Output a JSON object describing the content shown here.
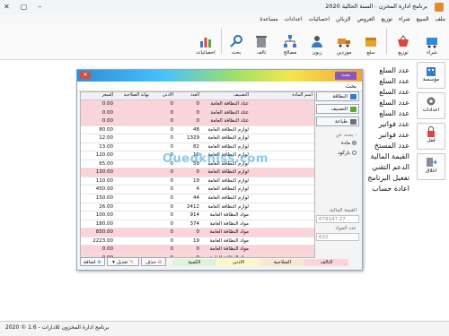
{
  "window": {
    "title": "برنامج ادارة المخزن - السنة الحالية 2020"
  },
  "menu": [
    "ملف",
    "المبيع",
    "شراء",
    "توزيع",
    "العروض",
    "الزبائن",
    "احصائيات",
    "اعدادات",
    "مساعدة"
  ],
  "toolbar": [
    {
      "label": "شراء",
      "icon": "cart-icon"
    },
    {
      "label": "توزيع",
      "icon": "basket-icon"
    },
    {
      "label": "سلع",
      "icon": "box-icon"
    },
    {
      "label": "موردين",
      "icon": "truck-icon"
    },
    {
      "label": "زبون",
      "icon": "person-icon"
    },
    {
      "label": "مصالح",
      "icon": "network-icon"
    },
    {
      "label": "تالف",
      "icon": "trash-icon"
    },
    {
      "label": "بحث",
      "icon": "search-icon"
    },
    {
      "label": "احصائيات",
      "icon": "chart-icon"
    }
  ],
  "sidebar": [
    {
      "label": "مؤسسة",
      "icon": "building-icon"
    },
    {
      "label": "اعدادات",
      "icon": "gear-icon"
    },
    {
      "label": "قفل",
      "icon": "lock-icon"
    },
    {
      "label": "اغلاق",
      "icon": "exit-icon"
    }
  ],
  "background_labels": [
    "عدد السلع",
    "عدد السلع",
    "عدد السلع",
    "عدد السلع",
    "عدد السلع",
    "عدد فواتير",
    "عدد فواتير",
    "عدد المستخ",
    "القيمة المالية",
    "الدعم التقني",
    "تفعيل البرنامج",
    "اعادة حساب"
  ],
  "dialog": {
    "caption": "بحث",
    "subtitle": "بحث",
    "columns": {
      "name": "اسم المادة",
      "class": "التصنيف",
      "qty": "العدد",
      "min": "الأدنى",
      "exp": "نهاية الصلاحية",
      "price": "السعر"
    },
    "rows": [
      {
        "name": "",
        "class": "عتاد النظافة العامة",
        "qty": "0",
        "min": "0",
        "exp": "",
        "price": "0.00",
        "pink": true
      },
      {
        "name": "",
        "class": "عتاد النظافة العامة",
        "qty": "0",
        "min": "0",
        "exp": "",
        "price": "0.00",
        "pink": true
      },
      {
        "name": "",
        "class": "عتاد النظافة العامة",
        "qty": "0",
        "min": "0",
        "exp": "",
        "price": "0.00",
        "pink": true
      },
      {
        "name": "",
        "class": "لوازم النظافة العامة",
        "qty": "48",
        "min": "0",
        "exp": "",
        "price": "80.00",
        "pink": false
      },
      {
        "name": "",
        "class": "لوازم النظافة العامة",
        "qty": "1329",
        "min": "0",
        "exp": "",
        "price": "12.00",
        "pink": false
      },
      {
        "name": "",
        "class": "لوازم النظافة العامة",
        "qty": "82",
        "min": "0",
        "exp": "",
        "price": "13.00",
        "pink": false
      },
      {
        "name": "",
        "class": "لوازم النظافة العامة",
        "qty": "10",
        "min": "0",
        "exp": "",
        "price": "120.00",
        "pink": false
      },
      {
        "name": "",
        "class": "لوازم النظافة العامة",
        "qty": "59",
        "min": "0",
        "exp": "",
        "price": "65.00",
        "pink": false
      },
      {
        "name": "",
        "class": "لوازم النظافة العامة",
        "qty": "0",
        "min": "0",
        "exp": "",
        "price": "130.00",
        "pink": true
      },
      {
        "name": "",
        "class": "لوازم النظافة العامة",
        "qty": "19",
        "min": "0",
        "exp": "",
        "price": "110.00",
        "pink": false
      },
      {
        "name": "",
        "class": "لوازم النظافة العامة",
        "qty": "4",
        "min": "0",
        "exp": "",
        "price": "450.00",
        "pink": false
      },
      {
        "name": "",
        "class": "لوازم النظافة العامة",
        "qty": "44",
        "min": "0",
        "exp": "",
        "price": "150.00",
        "pink": false
      },
      {
        "name": "",
        "class": "لوازم النظافة العامة",
        "qty": "2412",
        "min": "0",
        "exp": "",
        "price": "26.00",
        "pink": false
      },
      {
        "name": "",
        "class": "مواد النظافة العامة",
        "qty": "914",
        "min": "0",
        "exp": "",
        "price": "100.00",
        "pink": false
      },
      {
        "name": "",
        "class": "مواد النظافة العامة",
        "qty": "374",
        "min": "0",
        "exp": "",
        "price": "180.00",
        "pink": false
      },
      {
        "name": "",
        "class": "مواد النظافة العامة",
        "qty": "0",
        "min": "0",
        "exp": "",
        "price": "850.00",
        "pink": true
      },
      {
        "name": "",
        "class": "مواد النظافة العامة",
        "qty": "19",
        "min": "0",
        "exp": "",
        "price": "2223.00",
        "pink": false
      },
      {
        "name": "",
        "class": "مواد النظافة العامة",
        "qty": "0",
        "min": "0",
        "exp": "",
        "price": "0.00",
        "pink": true
      },
      {
        "name": "",
        "class": "مواد النظافة العامة",
        "qty": "0",
        "min": "0",
        "exp": "",
        "price": "0.00",
        "pink": true
      },
      {
        "name": "",
        "class": "مواد النظافة العامة",
        "qty": "0",
        "min": "0",
        "exp": "",
        "price": "0.00",
        "pink": true
      }
    ],
    "right_buttons": [
      "البطاقة",
      "التصنيف",
      "طباعة"
    ],
    "search_by_label": "بحث عن :",
    "radio_options": [
      {
        "label": "مادة",
        "checked": true
      },
      {
        "label": "باركود",
        "checked": false
      }
    ],
    "total_value_label": "القيمة المالية",
    "total_value": "679147.27",
    "count_label": "عدد المواد",
    "count_value": "632",
    "legend": [
      "التالف",
      "الصلاحية",
      "الادنى",
      "الكمية"
    ],
    "legend_colors": [
      "#fbd3d8",
      "#fbe7cf",
      "#fff6c8",
      "#dff3d8"
    ],
    "bottom_buttons": {
      "add": "اضافة",
      "edit": "تعديل",
      "delete": "حذف"
    },
    "watermark": "Ouedkniss.com"
  },
  "status": "برنامج ادارة المخزون للادارات - 1.6 © 2020"
}
